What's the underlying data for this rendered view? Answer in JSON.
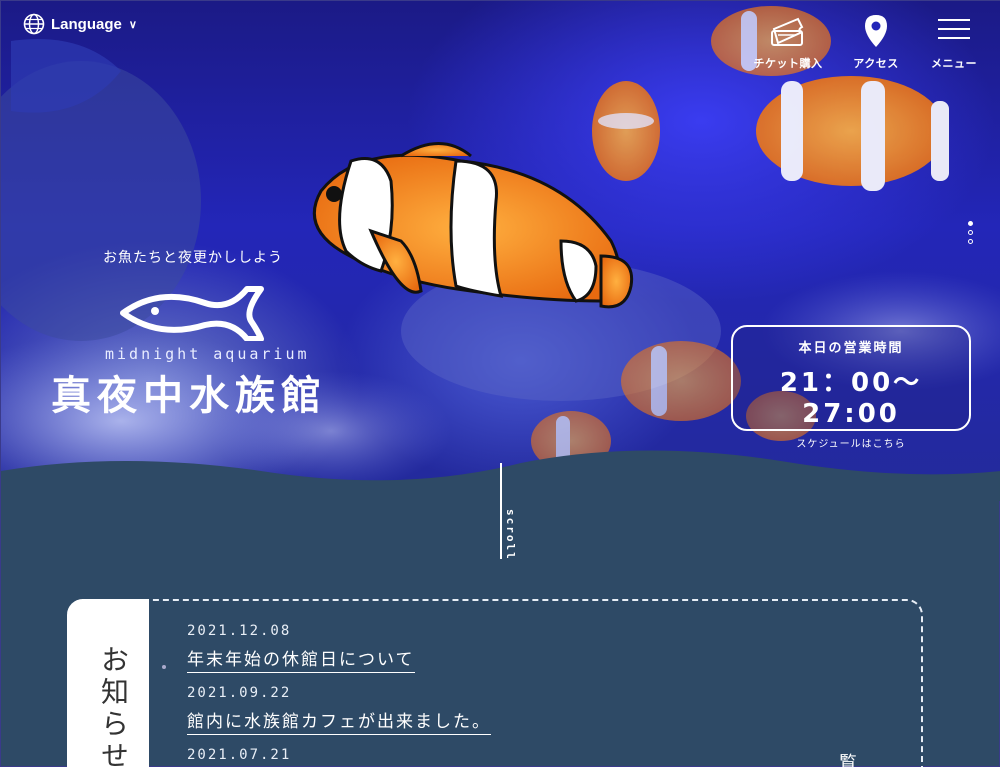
{
  "header": {
    "language_label": "Language",
    "nav": [
      {
        "label": "チケット購入",
        "icon": "ticket-icon"
      },
      {
        "label": "アクセス",
        "icon": "map-pin-icon"
      },
      {
        "label": "メニュー",
        "icon": "hamburger-menu-icon"
      }
    ]
  },
  "hero": {
    "tagline": "お魚たちと夜更かししよう",
    "logo_en": "midnight aquarium",
    "logo_jp": "真夜中水族館",
    "hours": {
      "label": "本日の営業時間",
      "time": "21：00〜27:00",
      "link": "スケジュールはこちら"
    },
    "scroll": "scroll",
    "slider": {
      "total": 3,
      "active": 1
    }
  },
  "news": {
    "title": "お知らせ",
    "items": [
      {
        "date": "2021.12.08",
        "text": "年末年始の休館日について"
      },
      {
        "date": "2021.09.22",
        "text": "館内に水族館カフェが出来ました。"
      },
      {
        "date": "2021.07.21",
        "text": ""
      }
    ],
    "more_partial": "覧"
  }
}
